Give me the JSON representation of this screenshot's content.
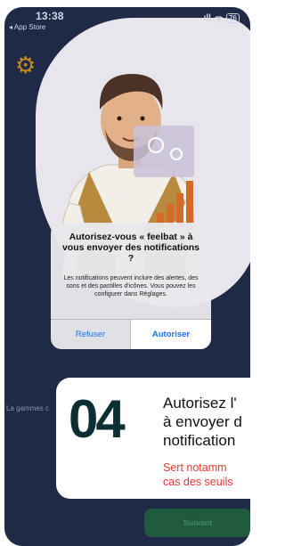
{
  "status_bar": {
    "time": "13:38",
    "back_label": "◂ App Store",
    "signal": "ıll",
    "wifi": "ᯤ",
    "battery": "76"
  },
  "background": {
    "label": "La gammes c"
  },
  "dialog": {
    "title": "Autorisez-vous « feelbat » à vous envoyer des notifications ?",
    "message": "Les notifications peuvent inclure des alertes, des sons et des pastilles d'icônes. Vous pouvez les configurer dans Réglages.",
    "refuse_label": "Refuser",
    "allow_label": "Autoriser"
  },
  "step_card": {
    "number": "04",
    "title_line1": "Autorisez l'",
    "title_line2": "à envoyer d",
    "title_line3": "notification",
    "subtitle_line1": "Sert notamm",
    "subtitle_line2": "cas des seuils"
  },
  "footer": {
    "next_label": "Suivant"
  },
  "colors": {
    "screen_bg": "#1e2a46",
    "blob": "#e9e5ec",
    "accent_blue": "#1a73e8",
    "number_color": "#0b2f33",
    "subtitle_red": "#e53935",
    "next_button_bg": "#1f5a3e"
  }
}
